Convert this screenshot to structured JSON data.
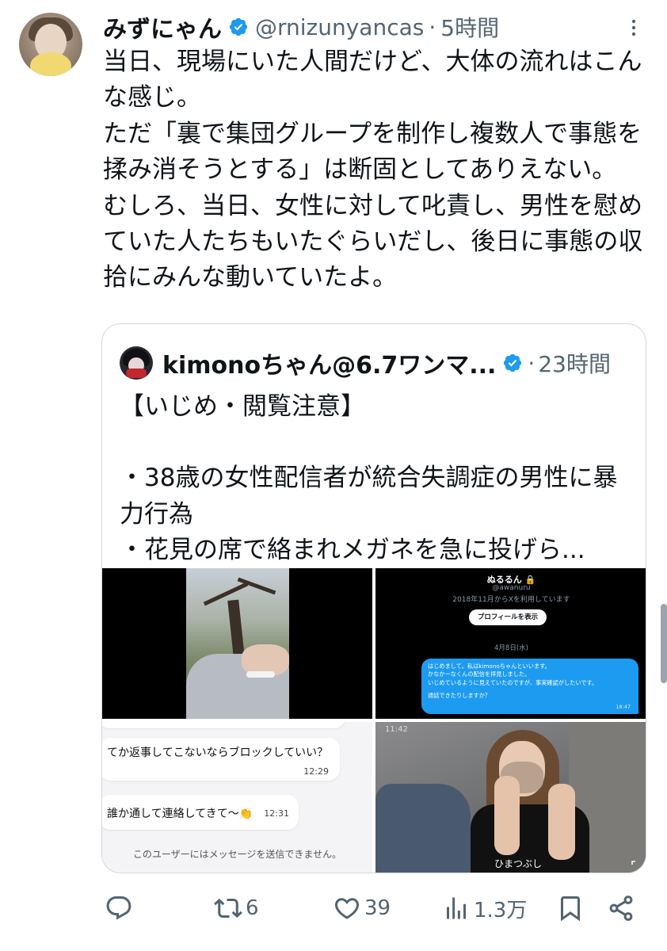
{
  "tweet": {
    "display_name": "みずにゃん",
    "handle": "@rnizunyancas",
    "separator": "·",
    "time": "5時間",
    "body": [
      "当日、現場にいた人間だけど、大体の流れはこんな感じ。",
      "ただ「裏で集団グループを制作し複数人で事態を揉み消そうとする」は断固としてありえない。",
      "むしろ、当日、女性に対して叱責し、男性を慰めていた人たちもいたぐらいだし、後日に事態の収拾にみんな動いていたよ。"
    ]
  },
  "quote": {
    "display_name": "kimonoちゃん@6.7ワンマ...",
    "separator": "·",
    "time": "23時間",
    "body": [
      "【いじめ・閲覧注意】",
      "",
      "・38歳の女性配信者が統合失調症の男性に暴力行為",
      "・花見の席で絡まれメガネを急に投げら..."
    ],
    "media": {
      "dm": {
        "name": "ぬるるん 🔒",
        "handle": "@awanuru",
        "since": "2018年11月からXを利用しています",
        "profile_button": "プロフィールを表示",
        "date": "4月8日(水)",
        "message": [
          "はじめまして。私はkimonoちゃんといいます。",
          "かなかーなくんの配信を拝見しました。",
          "いじめているように見えていたのですが、事実確認がしたいです。",
          "通話できたりしますか？"
        ],
        "message_time": "18:47"
      },
      "chat": {
        "msg1": "てか返事してこないならブロックしていい？",
        "msg1_time": "12:29",
        "msg2": "誰か通して連絡してきて〜👏",
        "msg2_time": "12:31",
        "notice": "このユーザーにはメッセージを送信できません。"
      },
      "photo": {
        "status_time": "11:42",
        "caption": "ひまつぶし"
      }
    }
  },
  "actions": {
    "retweets": "6",
    "likes": "39",
    "views": "1.3万"
  },
  "colors": {
    "text": "#0f1419",
    "secondary": "#536471",
    "verified": "#1d9bf0",
    "border": "#cfd9de"
  }
}
